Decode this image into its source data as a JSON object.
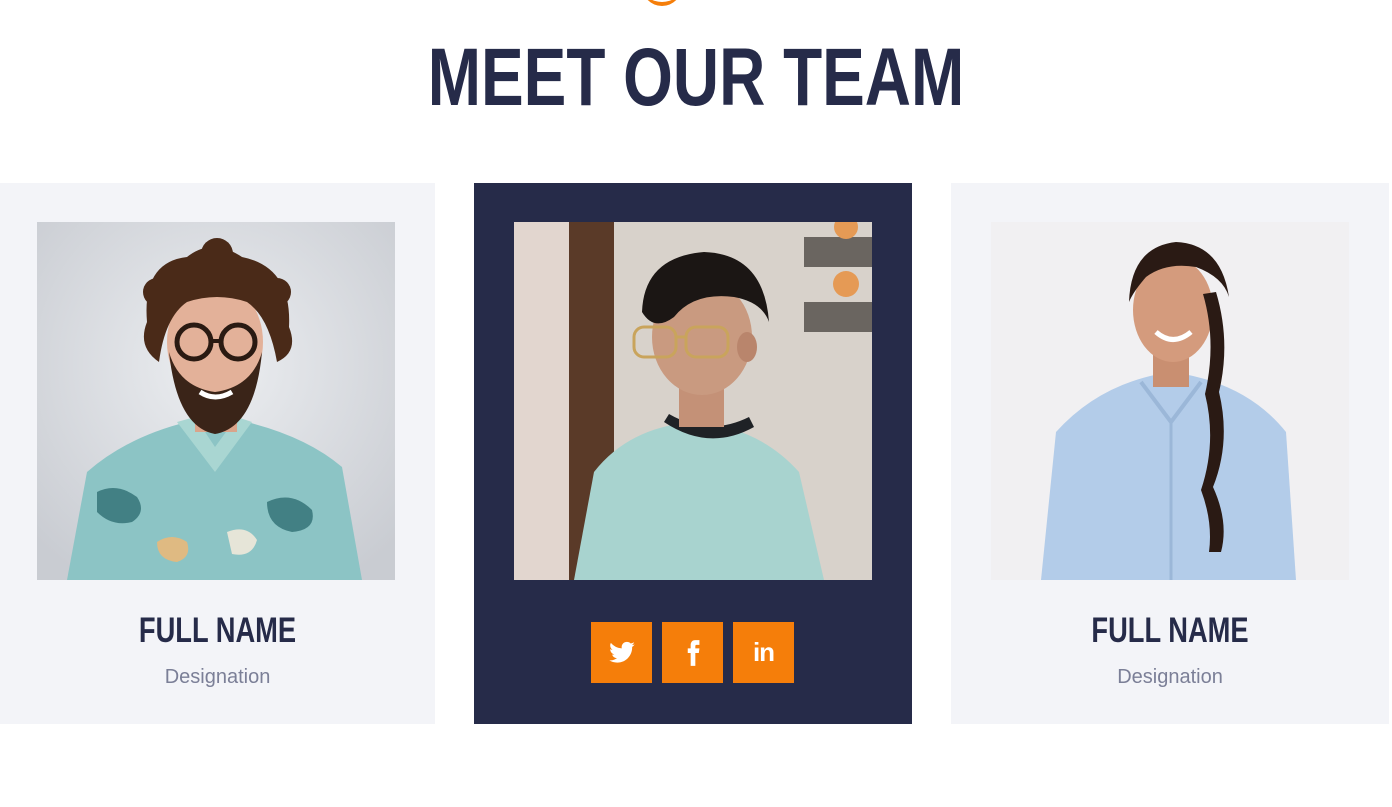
{
  "section": {
    "title": "MEET OUR TEAM"
  },
  "colors": {
    "navy": "#262b49",
    "orange": "#f57e0a",
    "card_bg": "#f3f4f8",
    "muted": "#7b7f97"
  },
  "members": [
    {
      "name": "FULL NAME",
      "designation": "Designation",
      "photo": "person-curly-hair-glasses-photo"
    },
    {
      "photo": "person-teen-glasses-photo",
      "socials": [
        {
          "icon": "twitter-icon",
          "label": "Twitter"
        },
        {
          "icon": "facebook-icon",
          "label": "Facebook"
        },
        {
          "icon": "linkedin-icon",
          "label": "in"
        }
      ]
    },
    {
      "name": "FULL NAME",
      "designation": "Designation",
      "photo": "person-braided-hair-photo"
    }
  ]
}
